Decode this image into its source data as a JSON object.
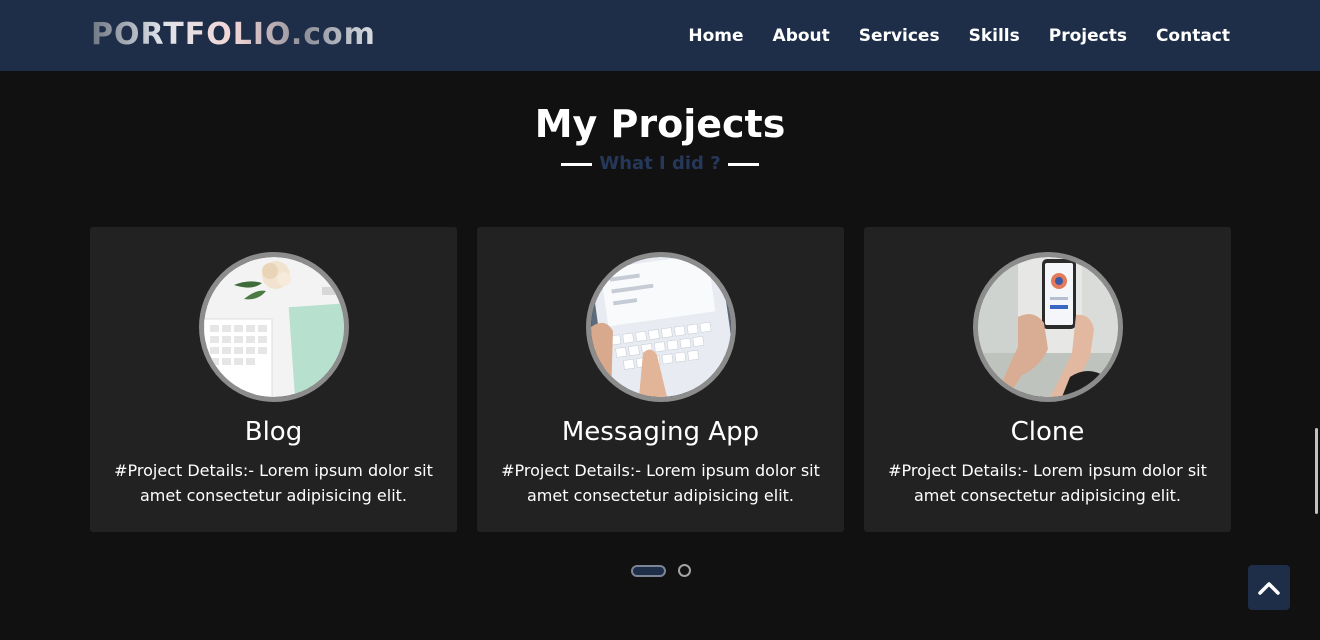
{
  "header": {
    "logo": "PORTFOLIO.com",
    "nav": [
      "Home",
      "About",
      "Services",
      "Skills",
      "Projects",
      "Contact"
    ]
  },
  "section": {
    "title": "My Projects",
    "subtitle": "What I did ?"
  },
  "projects": [
    {
      "title": "Blog",
      "details": "#Project Details:- Lorem ipsum dolor sit amet consectetur adipisicing elit.",
      "image": "desk-keyboard-notebook-image"
    },
    {
      "title": "Messaging App",
      "details": "#Project Details:- Lorem ipsum dolor sit amet consectetur adipisicing elit.",
      "image": "tablet-keyboard-image"
    },
    {
      "title": "Clone",
      "details": "#Project Details:- Lorem ipsum dolor sit amet consectetur adipisicing elit.",
      "image": "phone-in-hands-image"
    }
  ],
  "carousel": {
    "pages": 2,
    "active": 1
  },
  "icons": {
    "scroll_top": "chevron-up-icon"
  },
  "colors": {
    "navbar": "#1e2d48",
    "background": "#111111",
    "card": "#222222",
    "subtitle": "#26385a"
  }
}
